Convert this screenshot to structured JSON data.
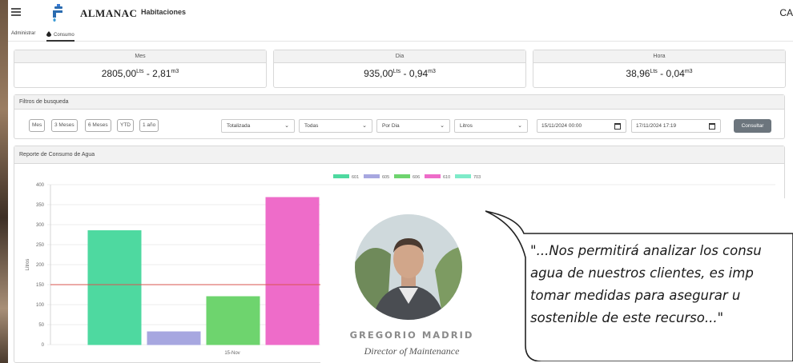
{
  "header": {
    "app_name": "ALMANAC",
    "module": "Habitaciones",
    "user_code": "CA"
  },
  "tabs": [
    {
      "label": "Administrar"
    },
    {
      "label": "Consumo"
    }
  ],
  "summary": {
    "mes": {
      "title": "Mes",
      "liters": "2805,00",
      "liters_unit": "Lts",
      "separator": " - ",
      "m3": "2,81",
      "m3_unit": "m3"
    },
    "dia": {
      "title": "Dia",
      "liters": "935,00",
      "liters_unit": "Lts",
      "separator": " - ",
      "m3": "0,94",
      "m3_unit": "m3"
    },
    "hora": {
      "title": "Hora",
      "liters": "38,96",
      "liters_unit": "Lts",
      "separator": " - ",
      "m3": "0,04",
      "m3_unit": "m3"
    }
  },
  "filters": {
    "title": "Filtros de busqueda",
    "quick_buttons": [
      "Mes",
      "3 Meses",
      "6 Meses",
      "YTD",
      "1 año"
    ],
    "selects": [
      "Totalizada",
      "Todas",
      "Por Dia",
      "Litros"
    ],
    "date_from": "15/11/2024 00:00",
    "date_to": "17/11/2024 17:19",
    "submit_label": "Consultar"
  },
  "report": {
    "title": "Reporte de Consumo de Agua"
  },
  "chart_data": {
    "type": "bar",
    "categories": [
      "15-Nov"
    ],
    "series": [
      {
        "name": "601",
        "values": [
          285
        ],
        "color": "#4ed9a0"
      },
      {
        "name": "605",
        "values": [
          32
        ],
        "color": "#a7a7e0"
      },
      {
        "name": "606",
        "values": [
          120
        ],
        "color": "#6ed46e"
      },
      {
        "name": "610",
        "values": [
          368
        ],
        "color": "#ee6cc9"
      },
      {
        "name": "703",
        "values": [
          255
        ],
        "color": "#7eebc9"
      }
    ],
    "ylabel": "Litros",
    "ylim": [
      0,
      400
    ],
    "yticks": [
      0,
      50,
      100,
      150,
      200,
      250,
      300,
      350,
      400
    ],
    "reference_line": {
      "value": 150,
      "color": "#d9534f"
    },
    "legend_position": "top",
    "grid": true
  },
  "testimonial": {
    "quote": "\"...Nos permitirá analizar los consu agua de nuestros clientes, es imp tomar medidas para asegurar u sostenible de este recurso...\"",
    "quote_lines": [
      "\"...Nos permitirá analizar los consu",
      "agua de nuestros clientes, es imp",
      "tomar medidas para asegurar u",
      "sostenible de este recurso...\""
    ],
    "name": "GREGORIO MADRID",
    "role": "Director of Maintenance"
  },
  "colors": {
    "consultar_button": "#6c757d",
    "panel_header": "#f2f2f2",
    "reference_line": "#d9534f"
  }
}
